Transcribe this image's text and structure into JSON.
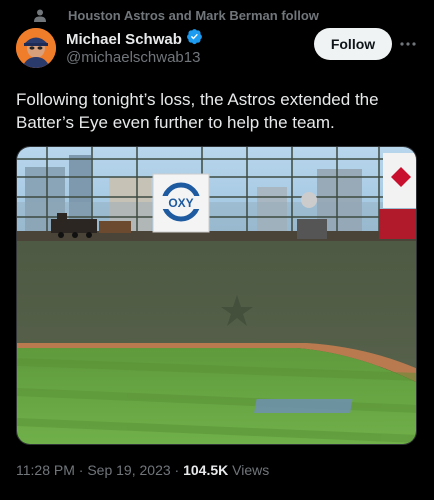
{
  "social_context": {
    "text": "Houston Astros and Mark Berman follow",
    "icon": "person-icon"
  },
  "author": {
    "display_name": "Michael Schwab",
    "handle": "@michaelschwab13",
    "verified": true,
    "verified_color": "#1d9bf0",
    "avatar_color": "#f07d2a"
  },
  "follow_button": {
    "label": "Follow"
  },
  "more_button": {
    "label": "···"
  },
  "tweet": {
    "text": "Following tonight’s loss, the Astros extended the Batter’s Eye even further to help the team."
  },
  "media": {
    "sign_text": "OXY"
  },
  "meta": {
    "time": "11:28 PM",
    "sep1": " · ",
    "date": "Sep 19, 2023",
    "sep2": " · ",
    "views_count": "104.5K",
    "views_label": " Views"
  }
}
